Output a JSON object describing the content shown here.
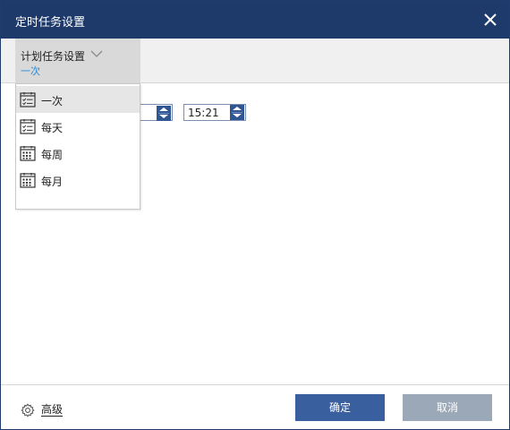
{
  "window": {
    "title": "定时任务设置",
    "close_icon": "close-icon"
  },
  "schedule": {
    "label": "计划任务设置",
    "selected": "一次",
    "dropdown_icon": "chevron-down-icon"
  },
  "menu": {
    "items": [
      {
        "label": "一次",
        "icon": "calendar-checklist-icon",
        "selected": true
      },
      {
        "label": "每天",
        "icon": "calendar-checklist-icon",
        "selected": false
      },
      {
        "label": "每周",
        "icon": "calendar-grid-icon",
        "selected": false
      },
      {
        "label": "每月",
        "icon": "calendar-grid-icon",
        "selected": false
      }
    ]
  },
  "time": {
    "value": "15:21"
  },
  "footer": {
    "advanced_label": "高级",
    "ok_label": "确定",
    "cancel_label": "取消"
  },
  "colors": {
    "titlebar": "#1e3a6a",
    "ok_button": "#3a5f9e",
    "cancel_button": "#9ba8b8",
    "accent_text": "#2b8ad6"
  }
}
